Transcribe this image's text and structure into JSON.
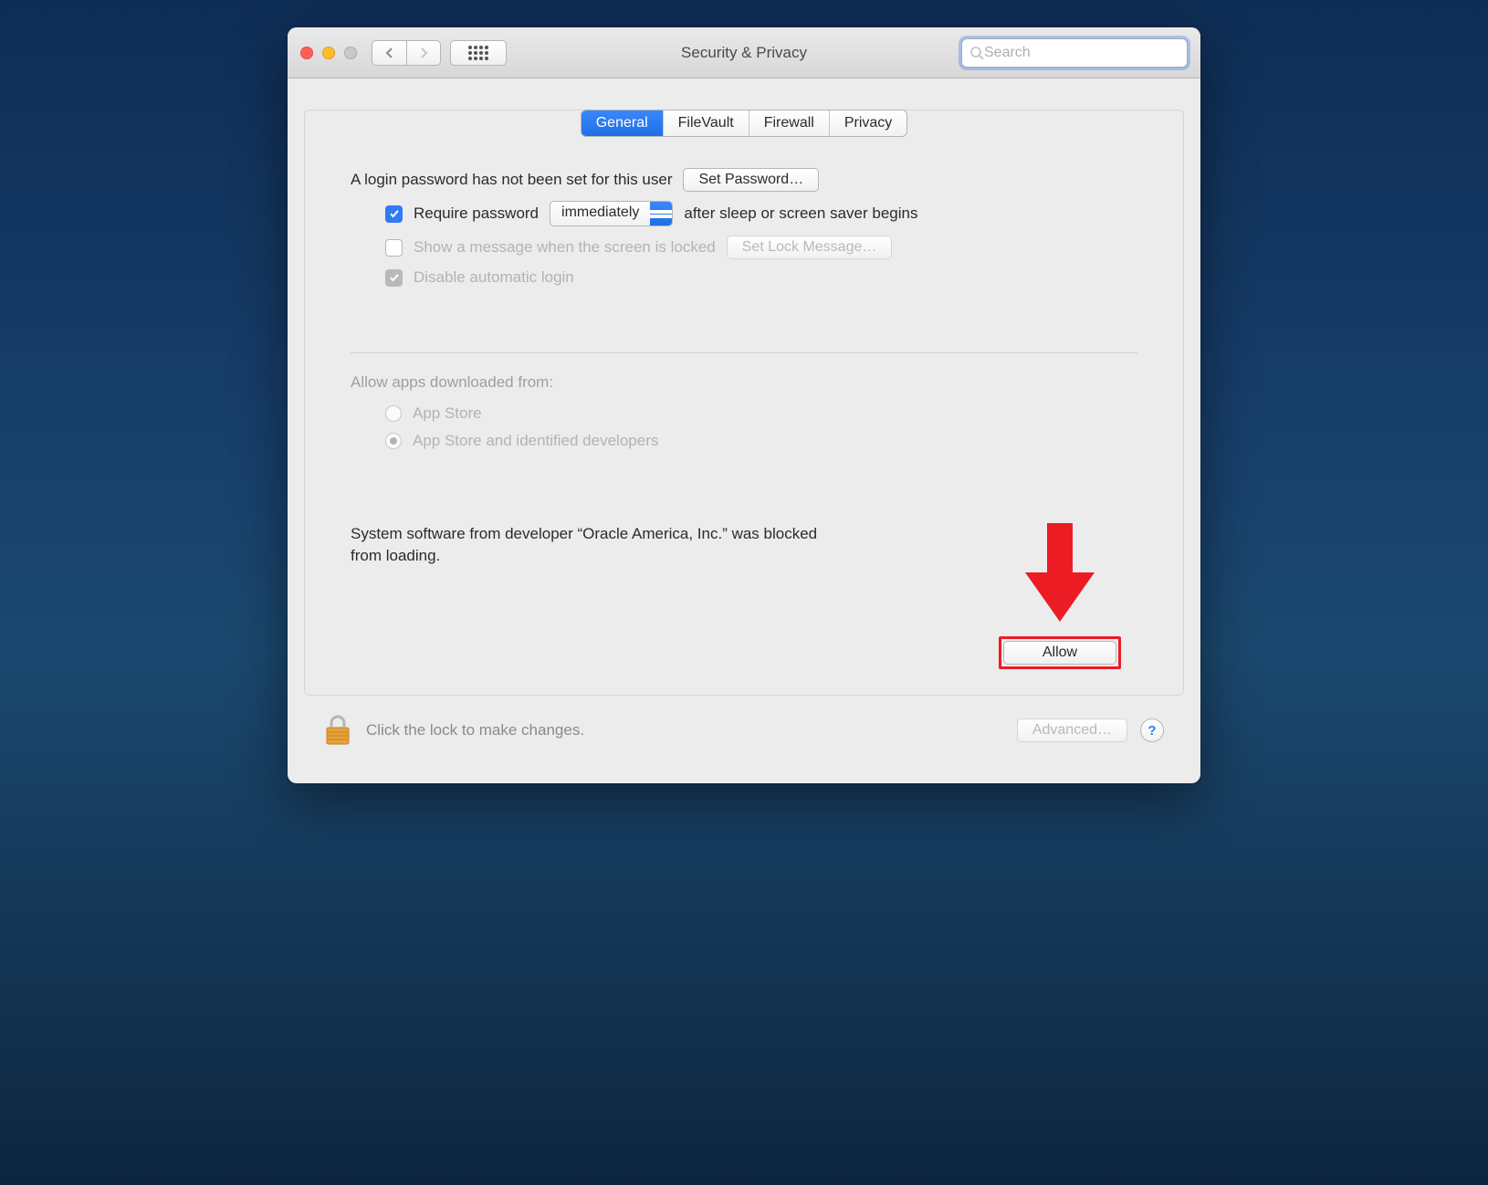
{
  "window": {
    "title": "Security & Privacy"
  },
  "toolbar": {
    "search_placeholder": "Search"
  },
  "tabs": {
    "items": [
      "General",
      "FileVault",
      "Firewall",
      "Privacy"
    ],
    "active_index": 0
  },
  "general": {
    "login_password_msg": "A login password has not been set for this user",
    "set_password_button": "Set Password…",
    "require_password_label": "Require password",
    "require_password_after": "after sleep or screen saver begins",
    "require_password_delay_options": [
      "immediately"
    ],
    "require_password_delay_selected": "immediately",
    "require_password_checked": true,
    "show_message_label": "Show a message when the screen is locked",
    "show_message_checked": false,
    "set_lock_message_button": "Set Lock Message…",
    "disable_auto_login_label": "Disable automatic login",
    "disable_auto_login_checked": true,
    "allow_apps_heading": "Allow apps downloaded from:",
    "allow_apps_options": [
      {
        "label": "App Store",
        "selected": false
      },
      {
        "label": "App Store and identified developers",
        "selected": true
      }
    ],
    "blocked_software_message": "System software from developer “Oracle America, Inc.” was blocked from loading.",
    "allow_button": "Allow"
  },
  "footer": {
    "lock_hint": "Click the lock to make changes.",
    "advanced_button": "Advanced…",
    "help_button": "?"
  },
  "annotation": {
    "arrow_color": "#ec1c24"
  }
}
